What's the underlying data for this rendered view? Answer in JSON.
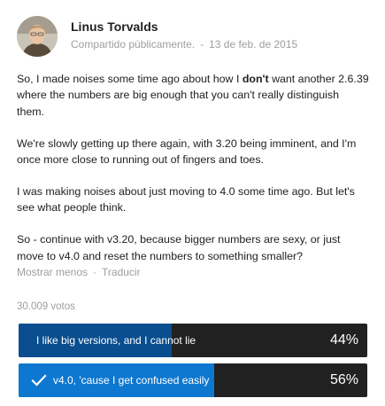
{
  "post": {
    "author": "Linus Torvalds",
    "visibility": "Compartido públicamente",
    "date": "13 de feb. de 2015",
    "paragraphs": {
      "p1_before": "So, I made noises some time ago about how I ",
      "p1_bold": "don't",
      "p1_after": " want another 2.6.39 where the numbers are big enough that you can't really distinguish them.",
      "p2": "We're slowly getting up there again, with 3.20 being imminent, and I'm once more close to running out of fingers and toes.",
      "p3": "I was making noises about just moving to 4.0 some time ago. But let's see what people think.",
      "p4": "So - continue with v3.20, because bigger numbers are sexy, or just move to v4.0 and reset the numbers to something smaller?"
    },
    "show_less": "Mostrar menos",
    "translate": "Traducir"
  },
  "poll": {
    "votes": "30.009 votos",
    "options": [
      {
        "label": "I like big versions, and I cannot lie",
        "percent_text": "44%",
        "fraction": 0.44,
        "selected": false
      },
      {
        "label": "v4.0, 'cause I get confused easily",
        "percent_text": "56%",
        "fraction": 0.56,
        "selected": true
      }
    ]
  },
  "colors": {
    "option_bg": "#212121",
    "fill_unselected": "#0a4e8f",
    "fill_selected": "#0e78d0",
    "meta_text": "#9e9e9e"
  },
  "icons": {
    "avatar": "author-avatar",
    "selected": "check-icon"
  }
}
